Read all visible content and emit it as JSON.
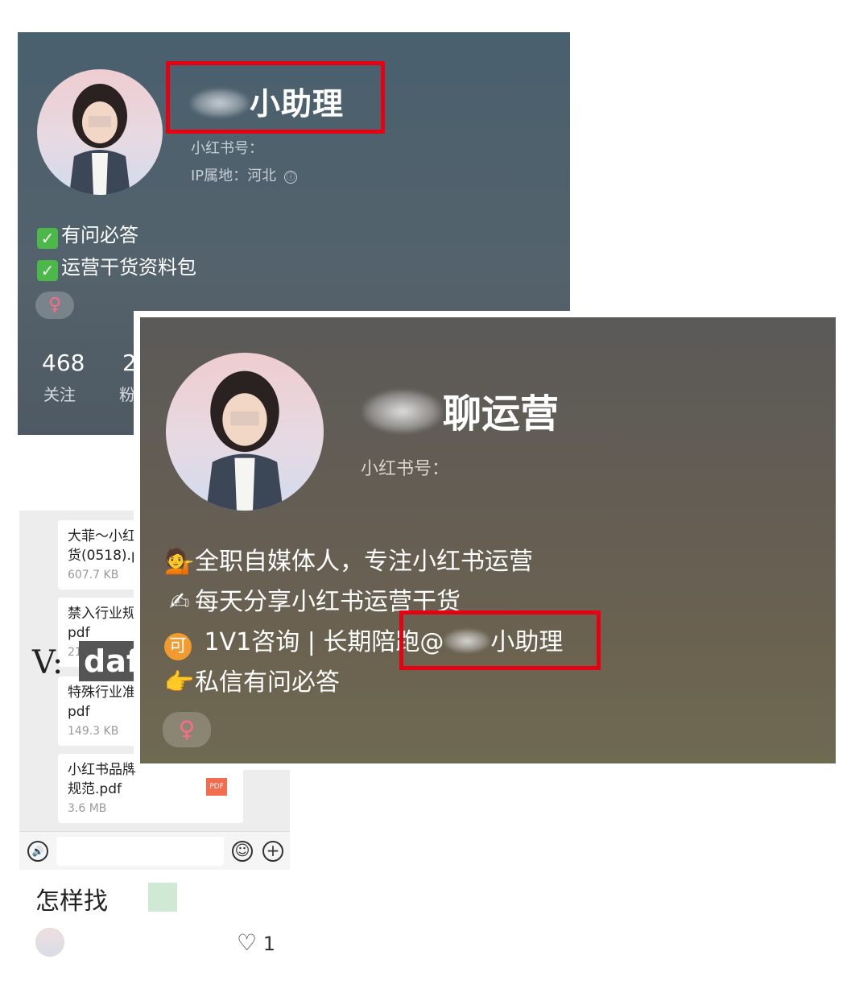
{
  "top_profile": {
    "name": "小助理",
    "red_id_label": "小红书号：",
    "ip_location": "IP属地：河北",
    "info_icon": "ⓘ",
    "bio": [
      "有问必答",
      "运营干货资料包"
    ],
    "check_icon": "✓",
    "gender_icon": "♀",
    "stats": [
      {
        "num": "468",
        "label": "关注"
      },
      {
        "num": "2",
        "label": "粉"
      }
    ]
  },
  "chat": {
    "files": [
      {
        "name_line1": "大菲～小红",
        "name_line2": "货(0518).p",
        "size": "607.7 KB"
      },
      {
        "name_line1": "禁入行业规",
        "name_line2": "pdf",
        "size": "21"
      },
      {
        "name_line1": "特殊行业准",
        "name_line2": "pdf",
        "size": "149.3 KB"
      },
      {
        "name_line1": "小红书品牌",
        "name_line2": "规范.pdf",
        "size": "3.6 MB",
        "badge": "PDF"
      }
    ],
    "voice_icon": "🔊",
    "emoji_icon": "☺",
    "plus_icon": "+"
  },
  "watermark": {
    "label": "V:",
    "value": "daf"
  },
  "note": {
    "title": "怎样找",
    "like_icon": "♡",
    "like_count": "1"
  },
  "big_profile": {
    "name": "聊运营",
    "red_id_label": "小红书号：",
    "bio": [
      {
        "emoji": "💁",
        "text": "全职自媒体人，专注小红书运营"
      },
      {
        "emoji": "✍",
        "text": "每天分享小红书运营干货"
      },
      {
        "emoji": "可",
        "text_before": " 1V1咨询 | 长期陪跑@",
        "text_after": "小助理"
      },
      {
        "emoji": "👉",
        "text": "私信有问必答"
      }
    ],
    "gender_icon": "♀"
  },
  "colors": {
    "highlight_border": "#e50012",
    "top_card_bg": "#4f5f6b",
    "big_card_bg": "#655e53",
    "female_pink": "#ff6b86"
  }
}
